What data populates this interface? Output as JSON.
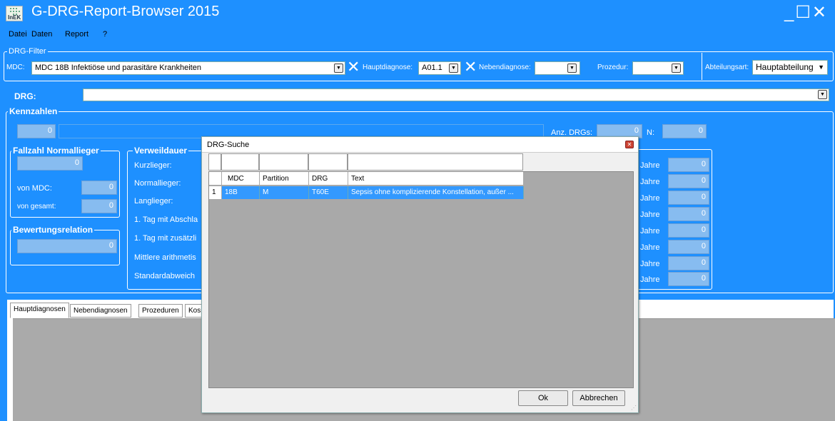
{
  "app": {
    "title": "G-DRG-Report-Browser 2015",
    "logo_text": "InEK"
  },
  "window_controls": {
    "label": "_☐✕"
  },
  "menu": [
    "Datei",
    "Daten",
    "Report",
    "?"
  ],
  "filter": {
    "legend": "DRG-Filter",
    "mdc_label": "MDC:",
    "mdc_value": "MDC 18B Infektiöse und parasitäre Krankheiten",
    "hauptdiagnose_label": "Hauptdiagnose:",
    "hauptdiagnose_value": "A01.1",
    "nebendiagnose_label": "Nebendiagnose:",
    "nebendiagnose_value": "",
    "prozedur_label": "Prozedur:",
    "prozedur_value": "",
    "abteilungsart_label": "Abteilungsart:",
    "abteilungsart_value": "Hauptabteilung"
  },
  "drg": {
    "label": "DRG:",
    "value": ""
  },
  "kennzahlen": {
    "legend": "Kennzahlen",
    "top_value": "0",
    "anz_drgs_label": "Anz. DRGs:",
    "anz_drgs_value": "0",
    "n_label": "N:",
    "n_value": "0"
  },
  "fallzahl": {
    "legend": "Fallzahl Normallieger",
    "value": "0",
    "von_mdc_label": "von MDC:",
    "von_mdc_value": "0",
    "von_gesamt_label": "von gesamt:",
    "von_gesamt_value": "0"
  },
  "bewertung": {
    "legend": "Bewertungsrelation",
    "value": "0"
  },
  "verweildauer": {
    "legend": "Verweildauer",
    "rows": [
      "Kurzlieger:",
      "Normallieger:",
      "Langlieger:",
      "1. Tag mit Abschla",
      "1. Tag mit zusätzli",
      "Mittlere arithmetis",
      "Standardabweich"
    ]
  },
  "alter": {
    "rows": [
      {
        "label": "Jahre",
        "value": "0"
      },
      {
        "label": "Jahre",
        "value": "0"
      },
      {
        "label": "Jahre",
        "value": "0"
      },
      {
        "label": "Jahre",
        "value": "0"
      },
      {
        "label": "Jahre",
        "value": "0"
      },
      {
        "label": "Jahre",
        "value": "0"
      },
      {
        "label": "Jahre",
        "value": "0"
      },
      {
        "label": "Jahre",
        "value": "0"
      }
    ]
  },
  "tabs": [
    "Hauptdiagnosen",
    "Nebendiagnosen",
    "Prozeduren",
    "Kos"
  ],
  "dialog": {
    "title": "DRG-Suche",
    "close_glyph": "✕",
    "columns": [
      "MDC",
      "Partition",
      "DRG",
      "Text"
    ],
    "rows": [
      {
        "index": "1",
        "mdc": "18B",
        "partition": "M",
        "drg": "T60E",
        "text": "Sepsis ohne komplizierende Konstellation, außer ..."
      }
    ],
    "ok_label": "Ok",
    "cancel_label": "Abbrechen"
  },
  "colors": {
    "accent": "#1e90ff",
    "field": "#87bcf0",
    "selection": "#3399ff"
  }
}
